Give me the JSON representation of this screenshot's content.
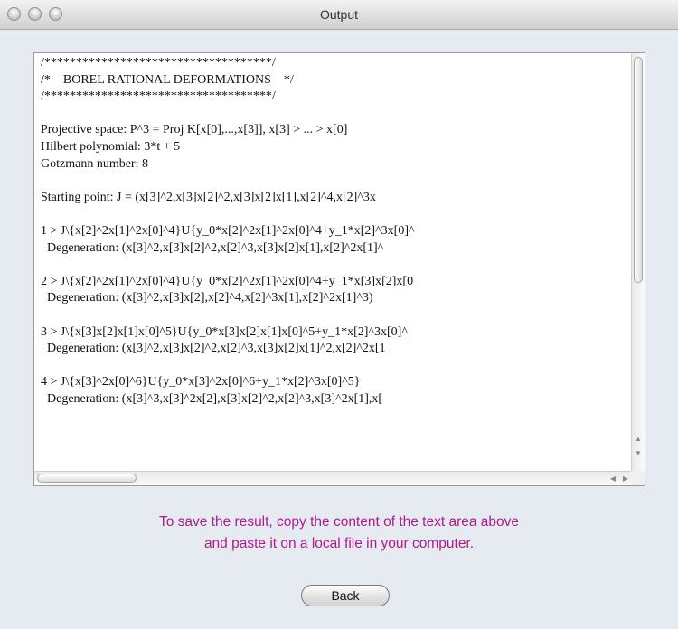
{
  "window": {
    "title": "Output"
  },
  "output": {
    "lines": [
      "/************************************/",
      "/*    BOREL RATIONAL DEFORMATIONS    */",
      "/************************************/",
      "",
      "Projective space: P^3 = Proj K[x[0],...,x[3]], x[3] > ... > x[0]",
      "Hilbert polynomial: 3*t + 5",
      "Gotzmann number: 8",
      "",
      "Starting point: J = (x[3]^2,x[3]x[2]^2,x[3]x[2]x[1],x[2]^4,x[2]^3x",
      "",
      "1 > J\\{x[2]^2x[1]^2x[0]^4}U{y_0*x[2]^2x[1]^2x[0]^4+y_1*x[2]^3x[0]^",
      "  Degeneration: (x[3]^2,x[3]x[2]^2,x[2]^3,x[3]x[2]x[1],x[2]^2x[1]^",
      "",
      "2 > J\\{x[2]^2x[1]^2x[0]^4}U{y_0*x[2]^2x[1]^2x[0]^4+y_1*x[3]x[2]x[0",
      "  Degeneration: (x[3]^2,x[3]x[2],x[2]^4,x[2]^3x[1],x[2]^2x[1]^3)",
      "",
      "3 > J\\{x[3]x[2]x[1]x[0]^5}U{y_0*x[3]x[2]x[1]x[0]^5+y_1*x[2]^3x[0]^",
      "  Degeneration: (x[3]^2,x[3]x[2]^2,x[2]^3,x[3]x[2]x[1]^2,x[2]^2x[1",
      "",
      "4 > J\\{x[3]^2x[0]^6}U{y_0*x[3]^2x[0]^6+y_1*x[2]^3x[0]^5}",
      "  Degeneration: (x[3]^3,x[3]^2x[2],x[3]x[2]^2,x[2]^3,x[3]^2x[1],x["
    ]
  },
  "message": {
    "line1": "To save the result, copy the content of the text area above",
    "line2": "and paste it on a local file in your computer."
  },
  "buttons": {
    "back_label": "Back"
  },
  "colors": {
    "message": "#b0198f",
    "background": "#e6ebf2"
  }
}
